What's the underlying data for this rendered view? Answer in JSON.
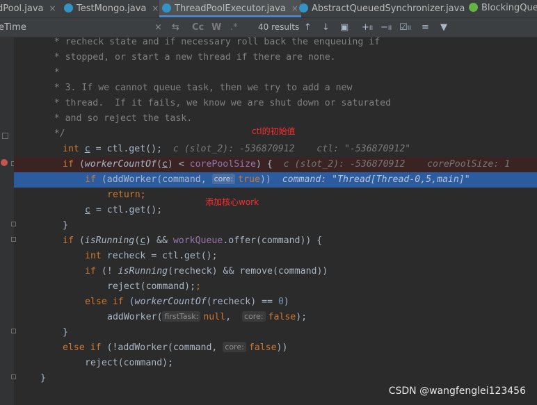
{
  "tabs": [
    {
      "label": "dPool.java",
      "icon": "java-class-icon",
      "color": "#cc7832"
    },
    {
      "label": "TestMongo.java",
      "icon": "java-class-icon",
      "color": "#3592c4"
    },
    {
      "label": "ThreadPoolExecutor.java",
      "icon": "java-class-icon",
      "color": "#3592c4"
    },
    {
      "label": "AbstractQueuedSynchronizer.java",
      "icon": "java-class-icon",
      "color": "#3592c4"
    },
    {
      "label": "BlockingQueu",
      "icon": "java-interface-icon",
      "color": "#62b543"
    }
  ],
  "tab_close": "×",
  "search": {
    "query": "eTime",
    "results": "40 results",
    "clear": "×",
    "match_case": "Cc",
    "words": "W",
    "regex": ".*"
  },
  "code": {
    "l1": "     * recheck state and if necessary roll back the enqueuing if",
    "l2": "     * stopped, or start a new thread if there are none.",
    "l3": "     *",
    "l4": "     * 3. If we cannot queue task, then we try to add a new",
    "l5": "     * thread.  If it fails, we know we are shut down or saturated",
    "l6": "     * and so reject the task.",
    "l7": "     */",
    "l8_kw": "int",
    "l8_var": "c",
    "l8_rest": " = ctl.get();",
    "l8_dbg": "c (slot_2): -536870912    ctl: \"-536870912\"",
    "l9_kw": "if",
    "l9_m": "workerCountOf",
    "l9_rest1": "(",
    "l9_var": "c",
    "l9_rest2": ") < ",
    "l9_fld": "corePoolSize",
    "l9_rest3": ") {",
    "l9_dbg": "c (slot_2): -536870912    corePoolSize: 1",
    "l10_kw": "if",
    "l10_a": " (addWorker(command, ",
    "l10_hint": "core:",
    "l10_b": "true",
    "l10_c": "))",
    "l10_dbg": "command: \"Thread[Thread-0,5,main]\"",
    "l11_kw": "return;",
    "l12_var": "c",
    "l12_rest": " = ctl.get();",
    "l13": "}",
    "l14_kw": "if",
    "l14_m": "isRunning",
    "l14_var": "c",
    "l14_fld": "workQueue",
    "l14_rest": ".offer(command)) {",
    "l15_kw": "int",
    "l15_rest": " recheck = ctl.get();",
    "l16_kw": "if",
    "l16_a": " (! ",
    "l16_m": "isRunning",
    "l16_b": "(recheck) && remove(command))",
    "l17": "reject(command);",
    "l18_kw1": "else",
    "l18_kw2": "if",
    "l18_m": "workerCountOf",
    "l18_a": "(recheck) == ",
    "l18_num": "0",
    "l18_b": ")",
    "l19_a": "addWorker(",
    "l19_hint": "firstTask:",
    "l19_null": "null",
    "l19_hint2": "core:",
    "l19_false": "false",
    "l19_b": ");",
    "l20": "}",
    "l21_kw1": "else",
    "l21_kw2": "if",
    "l21_a": " (!addWorker(command, ",
    "l21_hint": "core:",
    "l21_false": "false",
    "l21_b": "))",
    "l22": "reject(command);",
    "l23": "}"
  },
  "annotations": {
    "ctl_init": "ctl的初始值",
    "add_core_worker": "添加核心work"
  },
  "watermark": "CSDN @wangfenglei123456"
}
